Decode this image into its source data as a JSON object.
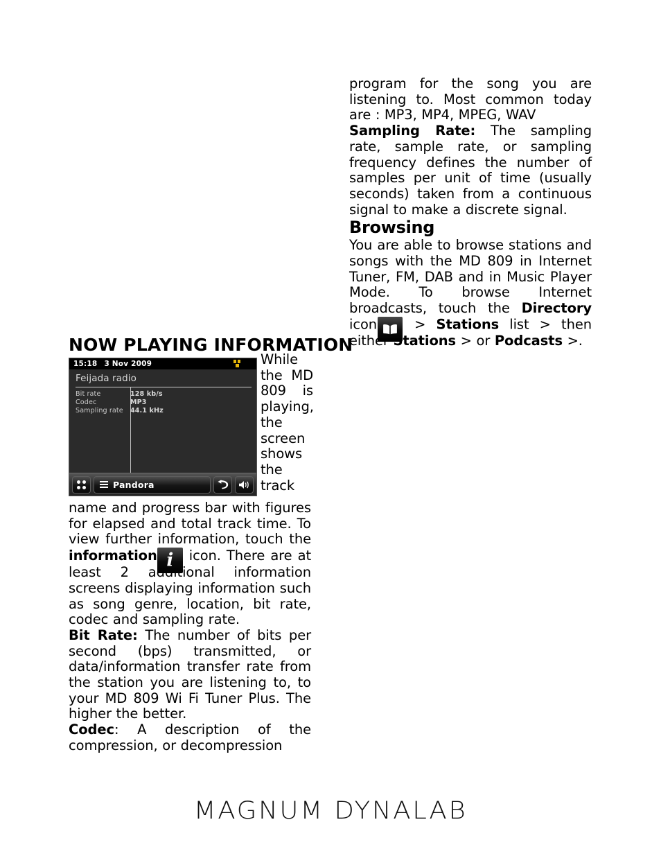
{
  "page": {
    "heading": "NOW PLAYING INFORMATION",
    "footer_logo": "MAGNUM DYNALAB"
  },
  "device_screen": {
    "status_bar": {
      "time": "15:18",
      "date": "3 Nov 2009",
      "signal_icon": "signal-strength-icon",
      "signal_color": "#e8b80a"
    },
    "title": "Feijada radio",
    "info_rows": [
      {
        "key": "Bit rate",
        "value": "128 kb/s"
      },
      {
        "key": "Codec",
        "value": "MP3"
      },
      {
        "key": "Sampling rate",
        "value": "44.1 kHz"
      }
    ],
    "toolbar": {
      "grid_icon": "grid-dots-icon",
      "menu_icon": "hamburger-menu-icon",
      "source_label": "Pandora",
      "back_icon": "back-arrow-icon",
      "volume_icon": "speaker-volume-icon"
    }
  },
  "left_column": {
    "wrap_text_1": "While the MD 809 is playing, the screen shows the track",
    "para_1_a": "name and progress bar with figures for elapsed and total track time. To view further information, touch the ",
    "para_1_bold": "information",
    "info_icon_name": "information-icon",
    "para_1_b": " icon. There are at least 2 additional information screens displaying information such as song genre, location, bit rate, codec and sampling rate.",
    "bit_rate_label": "Bit Rate:",
    "bit_rate_text": " The number of bits per second (bps) transmitted, or data/information transfer rate from the station you are listening to, to your MD 809 Wi Fi Tuner Plus. The higher the better.",
    "codec_label": "Codec",
    "codec_text": ": A description of the compression, or decompression"
  },
  "right_column": {
    "para_continued": "program for the song you are listening to. Most common today are : MP3, MP4, MPEG, WAV",
    "sampling_label": "Sampling Rate:",
    "sampling_text": " The sampling rate, sample rate, or sampling frequency defines the number of samples per unit of time (usually seconds) taken from a continuous signal to make a discrete signal.",
    "browsing_heading": "Browsing",
    "browsing_text_a": "You are able to browse stations and songs with the MD 809 in Internet Tuner, FM, DAB and in Music Player Mode. To browse Internet broadcasts, touch the ",
    "browsing_bold_directory": "Directory",
    "browsing_text_icon_lead": " icon",
    "directory_icon_name": "directory-book-icon",
    "browsing_text_b": " > ",
    "browsing_bold_stations_list": "Stations",
    "browsing_text_c": " list > then either ",
    "browsing_bold_stations": "Stations",
    "browsing_text_d": " > or ",
    "browsing_bold_podcasts": "Podcasts",
    "browsing_text_e": " >."
  }
}
